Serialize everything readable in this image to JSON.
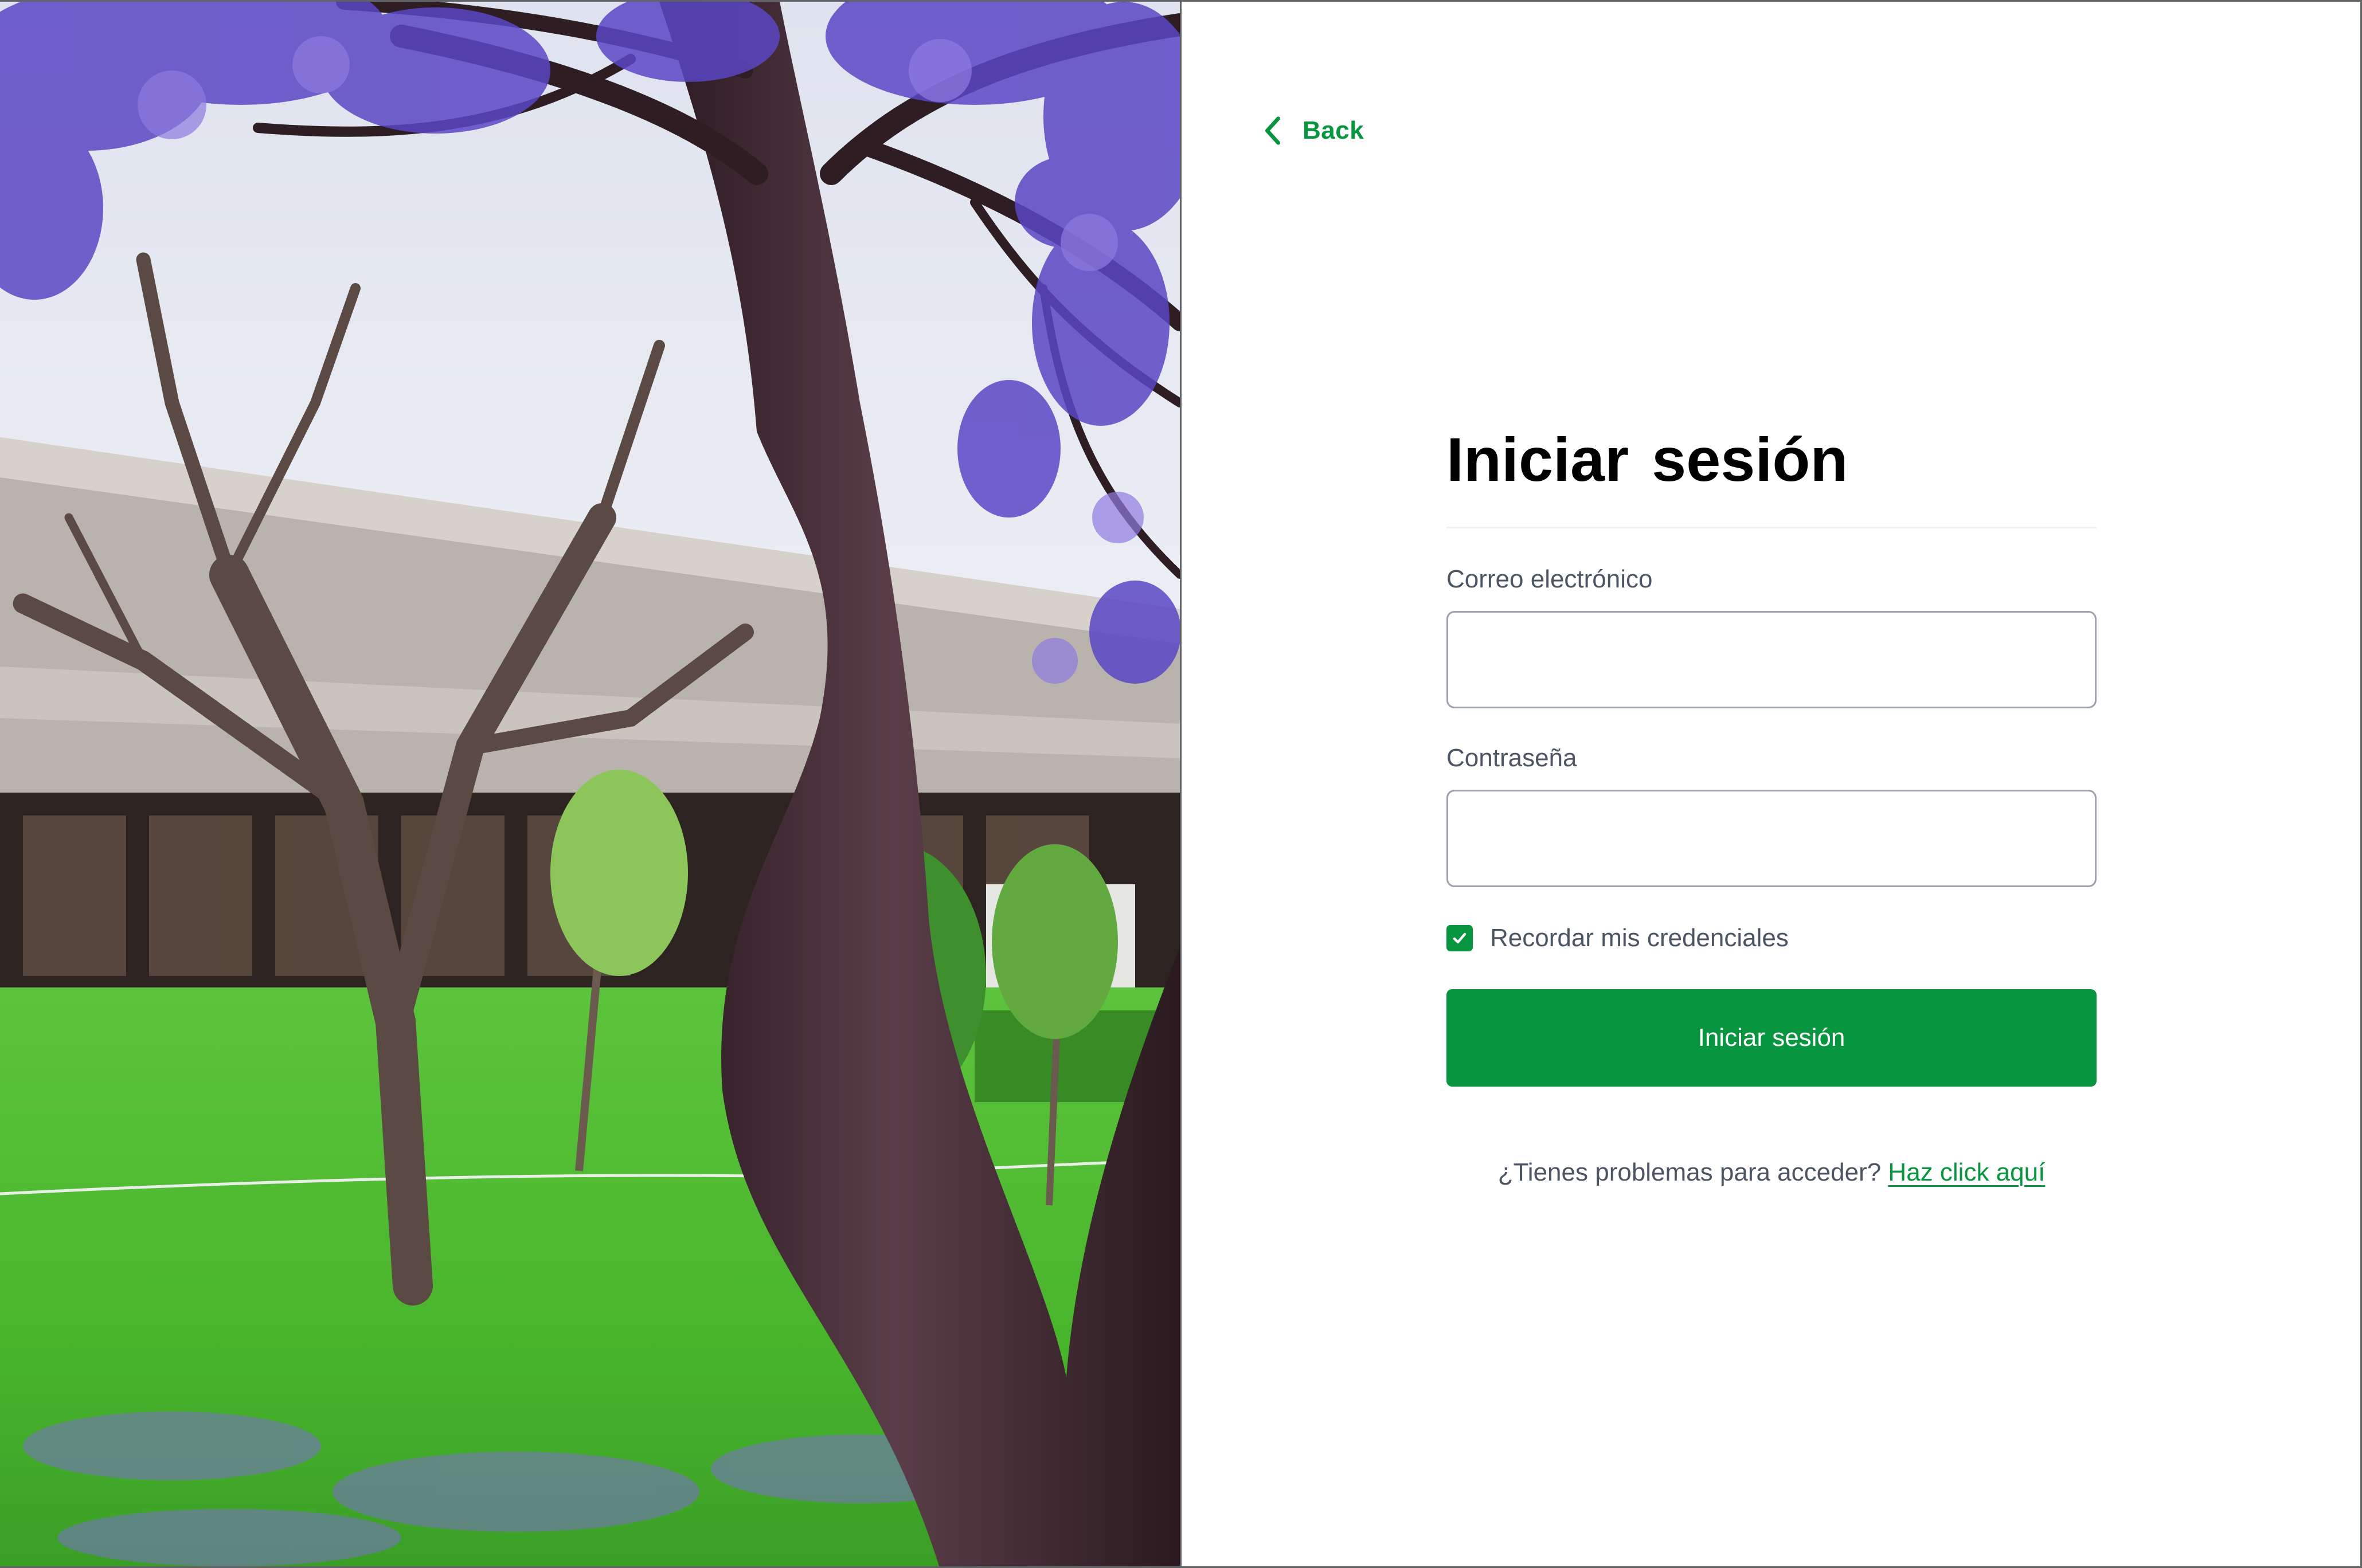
{
  "photo": {
    "description_icon": "campus-photo"
  },
  "nav": {
    "back_label": "Back",
    "back_icon": "chevron-left-icon"
  },
  "form": {
    "title": "Iniciar  sesión",
    "email_label": "Correo electrónico",
    "email_value": "",
    "email_placeholder": "",
    "password_label": "Contraseña",
    "password_value": "",
    "password_placeholder": "",
    "remember_label": "Recordar mis credenciales",
    "remember_checked": true,
    "submit_label": "Iniciar sesión",
    "help_text": "¿Tienes problemas para acceder?",
    "help_link": "Haz click aquí"
  },
  "colors": {
    "accent": "#07963f",
    "text_muted": "#4b5563",
    "title": "#000000",
    "input_border": "#9ca3af"
  }
}
